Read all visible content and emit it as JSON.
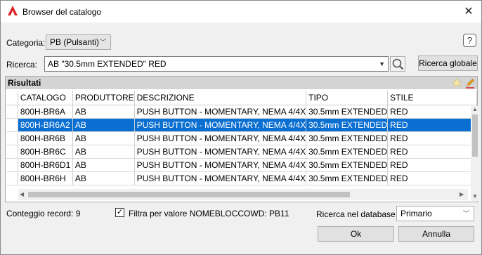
{
  "window": {
    "title": "Browser del catalogo"
  },
  "category": {
    "label": "Categoria:",
    "value": "PB (Pulsanti)"
  },
  "search": {
    "label": "Ricerca:",
    "value": "AB \"30.5mm EXTENDED\" RED",
    "global_button": "Ricerca globale"
  },
  "results": {
    "header": "Risultati",
    "columns": [
      "CATALOGO",
      "PRODUTTORE",
      "DESCRIZIONE",
      "TIPO",
      "STILE"
    ],
    "rows": [
      [
        "800H-BR6A",
        "AB",
        "PUSH BUTTON - MOMENTARY, NEMA 4/4X",
        "30.5mm EXTENDED",
        "RED"
      ],
      [
        "800H-BR6A2",
        "AB",
        "PUSH BUTTON - MOMENTARY, NEMA 4/4X",
        "30.5mm EXTENDED",
        "RED"
      ],
      [
        "800H-BR6B",
        "AB",
        "PUSH BUTTON - MOMENTARY, NEMA 4/4X",
        "30.5mm EXTENDED",
        "RED"
      ],
      [
        "800H-BR6C",
        "AB",
        "PUSH BUTTON - MOMENTARY, NEMA 4/4X",
        "30.5mm EXTENDED",
        "RED"
      ],
      [
        "800H-BR6D1",
        "AB",
        "PUSH BUTTON - MOMENTARY, NEMA 4/4X",
        "30.5mm EXTENDED",
        "RED"
      ],
      [
        "800H-BR6H",
        "AB",
        "PUSH BUTTON - MOMENTARY, NEMA 4/4X",
        "30.5mm EXTENDED",
        "RED"
      ]
    ],
    "selected_row": 1
  },
  "footer": {
    "record_count": "Conteggio record: 9",
    "filter_label": "Filtra per valore NOMEBLOCCOWD: PB11",
    "filter_checked": true,
    "db_label": "Ricerca nel database:",
    "db_value": "Primario",
    "ok": "Ok",
    "cancel": "Annulla"
  },
  "colors": {
    "selection": "#0a6fd1",
    "app_icon": "#d9232a"
  }
}
